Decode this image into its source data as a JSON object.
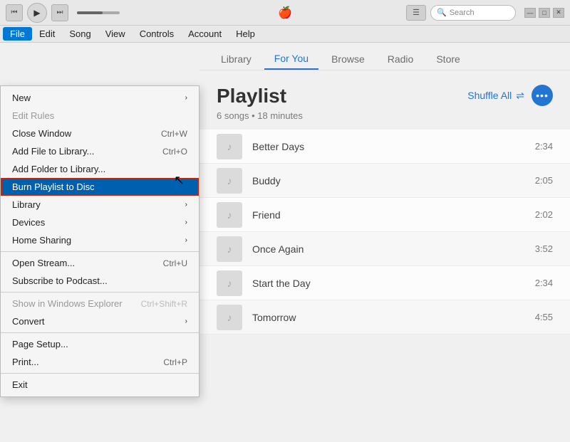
{
  "titleBar": {
    "appleSymbol": "🍎",
    "searchPlaceholder": "Search",
    "winControls": [
      "—",
      "□",
      "✕"
    ]
  },
  "menuBar": {
    "items": [
      "File",
      "Edit",
      "Song",
      "View",
      "Controls",
      "Account",
      "Help"
    ],
    "activeItem": "File"
  },
  "fileMenu": {
    "items": [
      {
        "id": "new",
        "label": "New",
        "shortcut": "",
        "hasArrow": true,
        "disabled": false,
        "separator_after": false
      },
      {
        "id": "edit-rules",
        "label": "Edit Rules",
        "shortcut": "",
        "hasArrow": false,
        "disabled": true,
        "separator_after": false
      },
      {
        "id": "close-window",
        "label": "Close Window",
        "shortcut": "Ctrl+W",
        "hasArrow": false,
        "disabled": false,
        "separator_after": false
      },
      {
        "id": "add-file",
        "label": "Add File to Library...",
        "shortcut": "Ctrl+O",
        "hasArrow": false,
        "disabled": false,
        "separator_after": false
      },
      {
        "id": "add-folder",
        "label": "Add Folder to Library...",
        "shortcut": "",
        "hasArrow": false,
        "disabled": false,
        "separator_after": false
      },
      {
        "id": "burn-playlist",
        "label": "Burn Playlist to Disc",
        "shortcut": "",
        "hasArrow": false,
        "disabled": false,
        "separator_after": false,
        "highlighted": true
      },
      {
        "id": "library",
        "label": "Library",
        "shortcut": "",
        "hasArrow": true,
        "disabled": false,
        "separator_after": false
      },
      {
        "id": "devices",
        "label": "Devices",
        "shortcut": "",
        "hasArrow": true,
        "disabled": false,
        "separator_after": false
      },
      {
        "id": "home-sharing",
        "label": "Home Sharing",
        "shortcut": "",
        "hasArrow": true,
        "disabled": false,
        "separator_after": true
      },
      {
        "id": "open-stream",
        "label": "Open Stream...",
        "shortcut": "Ctrl+U",
        "hasArrow": false,
        "disabled": false,
        "separator_after": false
      },
      {
        "id": "subscribe-podcast",
        "label": "Subscribe to Podcast...",
        "shortcut": "",
        "hasArrow": false,
        "disabled": false,
        "separator_after": true
      },
      {
        "id": "show-windows",
        "label": "Show in Windows Explorer",
        "shortcut": "Ctrl+Shift+R",
        "hasArrow": false,
        "disabled": true,
        "separator_after": false
      },
      {
        "id": "convert",
        "label": "Convert",
        "shortcut": "",
        "hasArrow": true,
        "disabled": false,
        "separator_after": true
      },
      {
        "id": "page-setup",
        "label": "Page Setup...",
        "shortcut": "",
        "hasArrow": false,
        "disabled": false,
        "separator_after": false
      },
      {
        "id": "print",
        "label": "Print...",
        "shortcut": "Ctrl+P",
        "hasArrow": false,
        "disabled": false,
        "separator_after": true
      },
      {
        "id": "exit",
        "label": "Exit",
        "shortcut": "",
        "hasArrow": false,
        "disabled": false,
        "separator_after": false
      }
    ]
  },
  "navTabs": {
    "items": [
      "Library",
      "For You",
      "Browse",
      "Radio",
      "Store"
    ],
    "activeTab": "For You"
  },
  "playlist": {
    "title": "Playlist",
    "meta": "6 songs • 18 minutes",
    "shuffleLabel": "Shuffle All",
    "moreLabel": "•••",
    "songs": [
      {
        "id": 1,
        "name": "Better Days",
        "duration": "2:34"
      },
      {
        "id": 2,
        "name": "Buddy",
        "duration": "2:05"
      },
      {
        "id": 3,
        "name": "Friend",
        "duration": "2:02"
      },
      {
        "id": 4,
        "name": "Once Again",
        "duration": "3:52"
      },
      {
        "id": 5,
        "name": "Start the Day",
        "duration": "2:34"
      },
      {
        "id": 6,
        "name": "Tomorrow",
        "duration": "4:55"
      }
    ]
  }
}
